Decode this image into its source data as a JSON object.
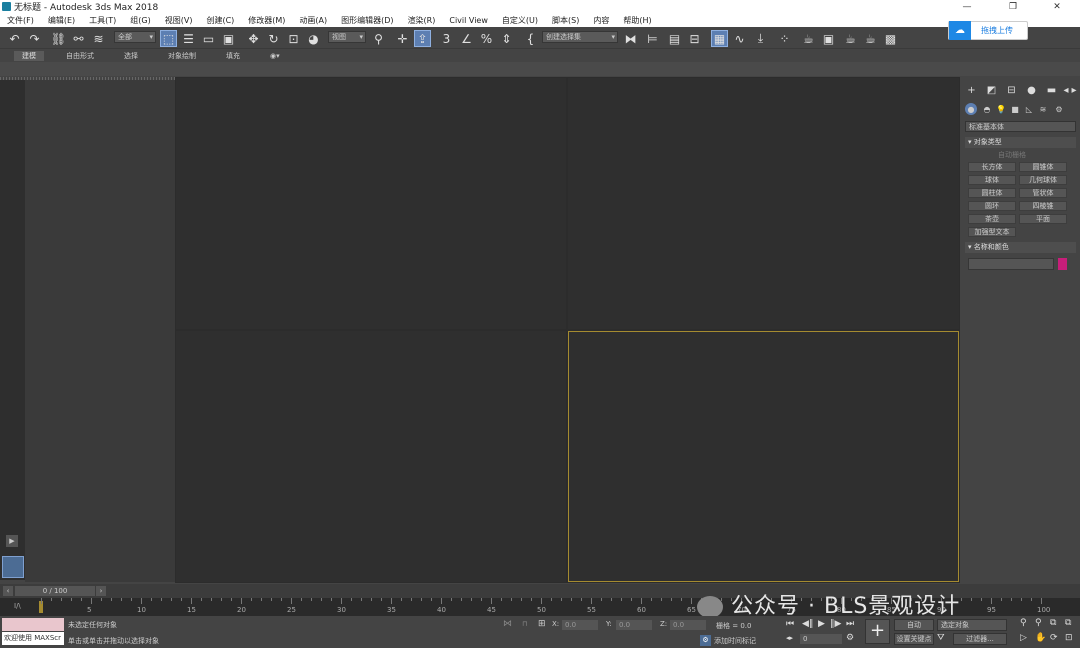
{
  "window": {
    "title": "无标题 - Autodesk 3ds Max 2018",
    "minimize": "—",
    "maximize": "❐",
    "close": "✕"
  },
  "menu": [
    "文件(F)",
    "编辑(E)",
    "工具(T)",
    "组(G)",
    "视图(V)",
    "创建(C)",
    "修改器(M)",
    "动画(A)",
    "图形编辑器(D)",
    "渲染(R)",
    "Civil View",
    "自定义(U)",
    "脚本(S)",
    "内容",
    "帮助(H)"
  ],
  "toolbar": {
    "selection_filter": "全部",
    "ref_coord": "视图",
    "named_selection": "创建选择集"
  },
  "upload": {
    "label": "拖拽上传"
  },
  "ribbon": {
    "tabs": [
      "建模",
      "自由形式",
      "选择",
      "对象绘制",
      "填充"
    ],
    "active": 0
  },
  "command_panel": {
    "category": "标准基本体",
    "rollout_object_type": "对象类型",
    "autogrid": "自动栅格",
    "buttons": [
      "长方体",
      "圆锥体",
      "球体",
      "几何球体",
      "圆柱体",
      "管状体",
      "圆环",
      "四棱锥",
      "茶壶",
      "平面",
      "加强型文本"
    ],
    "rollout_name_color": "名称和颜色",
    "object_color": "#c81e7a"
  },
  "time": {
    "frame_display": "0 / 100",
    "ticks": [
      5,
      10,
      15,
      20,
      25,
      30,
      35,
      40,
      45,
      50,
      55,
      60,
      65,
      70,
      75,
      80,
      85,
      90,
      95,
      100
    ]
  },
  "status": {
    "maxscript_label": "欢迎使用 MAXScr",
    "msg_top": "未选定任何对象",
    "msg_bottom": "单击或单击并拖动以选择对象",
    "x_label": "X:",
    "y_label": "Y:",
    "z_label": "Z:",
    "x_val": "0.0",
    "y_val": "0.0",
    "z_val": "0.0",
    "grid": "栅格 = 0.0",
    "add_time_tag": "添加时间标记",
    "auto": "自动",
    "set_key": "设置关键点",
    "selected": "选定对象",
    "key_filters": "过滤器...",
    "frame": "0"
  },
  "watermark": "公众号 · BLS景观设计"
}
